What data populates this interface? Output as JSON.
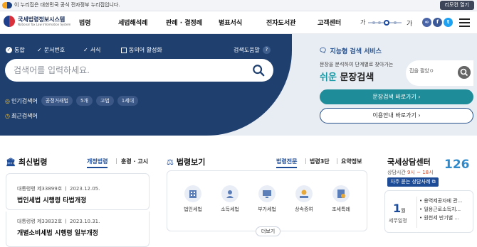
{
  "topbar": {
    "gov_notice": "이 누리집은 대한민국 공식 전자정부 누리집입니다.",
    "remote_label": "리모컨 열기"
  },
  "logo": {
    "title": "국세법령정보시스템",
    "subtitle": "National Tax Law Information System"
  },
  "gnb": {
    "menus": [
      "법령",
      "세법해석례",
      "판례 · 결정례",
      "별표서식",
      "전자도서관",
      "고객센터"
    ],
    "font_small": "가",
    "font_large": "가"
  },
  "search": {
    "options": [
      "통합",
      "문서번호",
      "서식",
      "동의어 활성화"
    ],
    "help_label": "검색도움말",
    "placeholder": "검색어를 입력하세요.",
    "popular_label": "인기검색어",
    "popular_tags": [
      "공정거래법",
      "5개",
      "고법",
      "1세대"
    ],
    "recent_label": "최근검색어"
  },
  "ai": {
    "title": "지능형 검색 서비스",
    "subtitle": "문장을 분석하여 단계별로 찾아가는",
    "heading_em": "쉬운",
    "heading_rest": " 문장검색",
    "input_text": "집을 팔았ㅇ",
    "btn_search": "문장검색 바로가기",
    "btn_guide": "이용안내 바로가기",
    "accent": "#1b9aa6"
  },
  "latest": {
    "title": "최신법령",
    "tabs": [
      "개정법령",
      "훈령 · 고시"
    ],
    "items": [
      {
        "meta": "대통령령 제33899호 ㅣ 2023.12.05.",
        "title": "법인세법 시행령 타법개정"
      },
      {
        "meta": "대통령령 제33832호 ㅣ 2023.10.31.",
        "title": "개별소비세법 시행령 일부개정"
      }
    ]
  },
  "lawview": {
    "title": "법령보기",
    "tabs": [
      "법령전문",
      "법령3단",
      "요약정보"
    ],
    "items": [
      "법인세법",
      "소득세법",
      "부가세법",
      "상속증여",
      "조세특례"
    ],
    "more": "더보기"
  },
  "counsel": {
    "title": "국세상담센터",
    "hours_label": "상담시간",
    "hours": "9시 ~ 18시",
    "faq": "자주 묻는 상담사례",
    "number": "126",
    "month": "1",
    "month_unit": "월",
    "schedule_label": "세무일정",
    "schedule": [
      "용역제공자에 관...",
      "일용근로소득지...",
      "원천세 반기별 ..."
    ]
  }
}
